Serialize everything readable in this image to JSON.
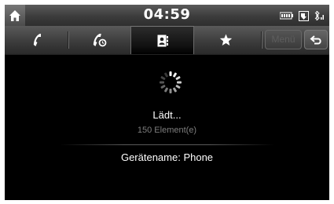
{
  "status_bar": {
    "time": "04:59",
    "icons": [
      "home-icon",
      "battery-icon",
      "phonebook-download-icon",
      "bluetooth-signal-icon"
    ]
  },
  "tabs": [
    {
      "name": "call-history",
      "icon": "phone-icon",
      "selected": false
    },
    {
      "name": "dial",
      "icon": "phone-dial-icon",
      "selected": false
    },
    {
      "name": "contacts",
      "icon": "contacts-book-icon",
      "selected": true
    },
    {
      "name": "favorites",
      "icon": "star-icon",
      "selected": false
    }
  ],
  "toolbar": {
    "menu_label": "Menü",
    "back_icon": "back-arrow-icon"
  },
  "content": {
    "loading_text": "Lädt...",
    "element_count": "150 Element(e)",
    "device_name": "Gerätename: Phone"
  },
  "colors": {
    "background": "#000000",
    "text": "#ffffff",
    "muted_text": "#7e7e7e",
    "bar_gradient_top": "#5a5a5a",
    "bar_gradient_bottom": "#2e2e2e"
  }
}
